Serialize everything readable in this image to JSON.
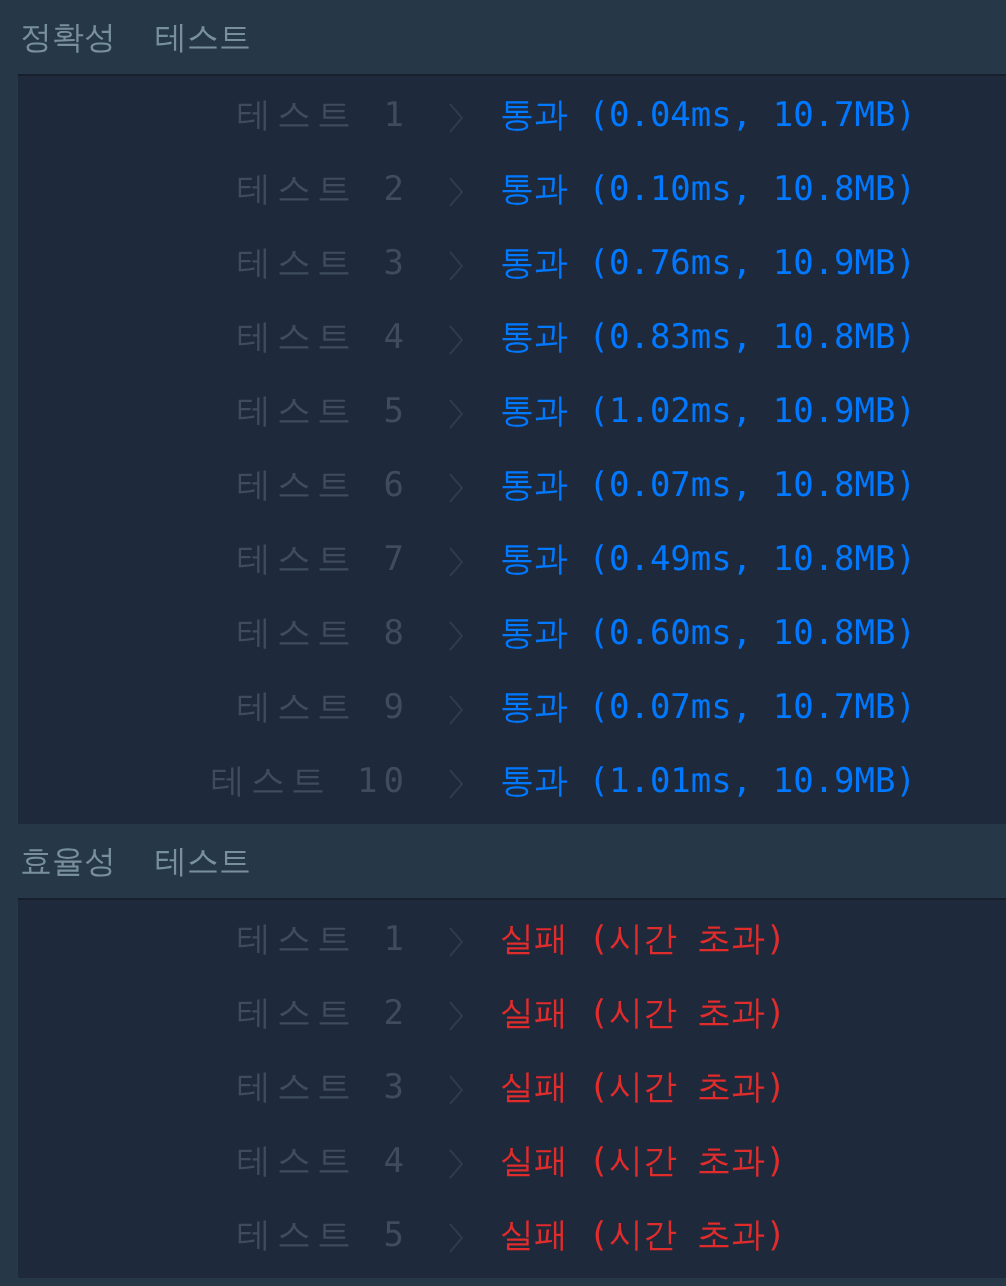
{
  "sections": [
    {
      "title": "정확성  테스트",
      "rows": [
        {
          "label": "테스트 1",
          "kind": "pass",
          "result": "통과 (0.04ms, 10.7MB)"
        },
        {
          "label": "테스트 2",
          "kind": "pass",
          "result": "통과 (0.10ms, 10.8MB)"
        },
        {
          "label": "테스트 3",
          "kind": "pass",
          "result": "통과 (0.76ms, 10.9MB)"
        },
        {
          "label": "테스트 4",
          "kind": "pass",
          "result": "통과 (0.83ms, 10.8MB)"
        },
        {
          "label": "테스트 5",
          "kind": "pass",
          "result": "통과 (1.02ms, 10.9MB)"
        },
        {
          "label": "테스트 6",
          "kind": "pass",
          "result": "통과 (0.07ms, 10.8MB)"
        },
        {
          "label": "테스트 7",
          "kind": "pass",
          "result": "통과 (0.49ms, 10.8MB)"
        },
        {
          "label": "테스트 8",
          "kind": "pass",
          "result": "통과 (0.60ms, 10.8MB)"
        },
        {
          "label": "테스트 9",
          "kind": "pass",
          "result": "통과 (0.07ms, 10.7MB)"
        },
        {
          "label": "테스트 10",
          "kind": "pass",
          "result": "통과 (1.01ms, 10.9MB)"
        }
      ]
    },
    {
      "title": "효율성  테스트",
      "rows": [
        {
          "label": "테스트 1",
          "kind": "fail",
          "result": "실패 (시간 초과)"
        },
        {
          "label": "테스트 2",
          "kind": "fail",
          "result": "실패 (시간 초과)"
        },
        {
          "label": "테스트 3",
          "kind": "fail",
          "result": "실패 (시간 초과)"
        },
        {
          "label": "테스트 4",
          "kind": "fail",
          "result": "실패 (시간 초과)"
        },
        {
          "label": "테스트 5",
          "kind": "fail",
          "result": "실패 (시간 초과)"
        }
      ]
    }
  ]
}
